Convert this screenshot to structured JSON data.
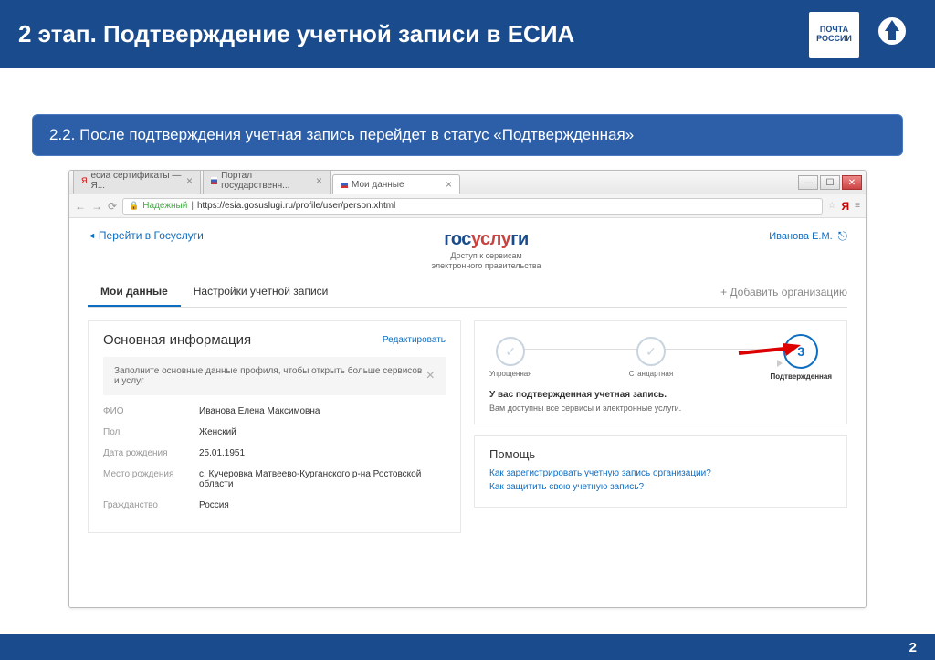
{
  "slide": {
    "title": "2 этап. Подтверждение учетной записи в ЕСИА",
    "caption": "2.2. После подтверждения учетная запись перейдет в статус «Подтвержденная»",
    "page_number": "2",
    "pochta_label": "ПОЧТА РОССИИ"
  },
  "browser": {
    "tabs": [
      {
        "title": "есиа сертификаты — Я..."
      },
      {
        "title": "Портал государственн..."
      },
      {
        "title": "Мои данные"
      }
    ],
    "secure_label": "Надежный",
    "url": "https://esia.gosuslugi.ru/profile/user/person.xhtml"
  },
  "page": {
    "back_link": "Перейти в Госуслуги",
    "brand_gos": "гос",
    "brand_usl": "услу",
    "brand_ugi": "ги",
    "brand_sub1": "Доступ к сервисам",
    "brand_sub2": "электронного правительства",
    "user_name": "Иванова Е.М.",
    "tabs": [
      {
        "label": "Мои данные"
      },
      {
        "label": "Настройки учетной записи"
      }
    ],
    "add_org": "+ Добавить организацию"
  },
  "info": {
    "title": "Основная информация",
    "edit": "Редактировать",
    "notice": "Заполните основные данные профиля, чтобы открыть больше сервисов и услуг",
    "fields": {
      "fio_label": "ФИО",
      "fio_value": "Иванова Елена Максимовна",
      "gender_label": "Пол",
      "gender_value": "Женский",
      "dob_label": "Дата рождения",
      "dob_value": "25.01.1951",
      "pob_label": "Место рождения",
      "pob_value": "с. Кучеровка Матвеево-Курганского р-на Ростовской области",
      "citizenship_label": "Гражданство",
      "citizenship_value": "Россия"
    }
  },
  "status": {
    "step1": "Упрощенная",
    "step2": "Стандартная",
    "step3": "Подтвержденная",
    "step3_num": "3",
    "headline": "У вас подтвержденная учетная запись.",
    "sub": "Вам доступны все сервисы и электронные услуги."
  },
  "help": {
    "title": "Помощь",
    "link1": "Как зарегистрировать учетную запись организации?",
    "link2": "Как защитить свою учетную запись?"
  }
}
